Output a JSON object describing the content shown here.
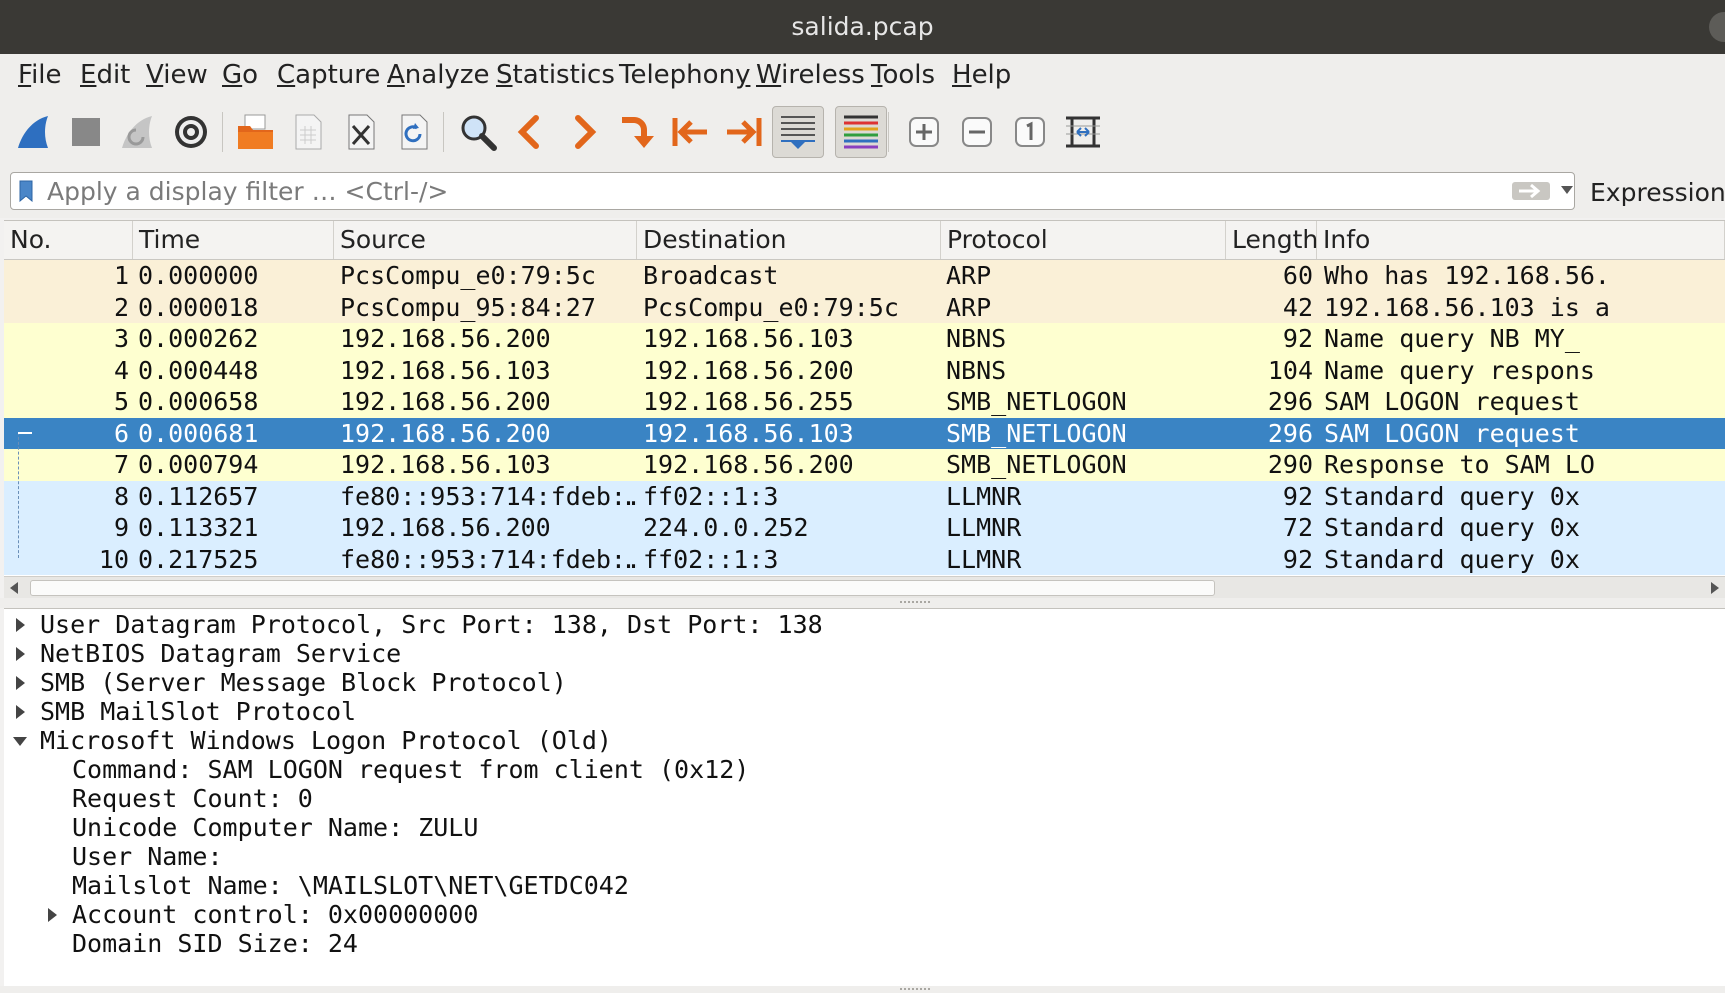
{
  "window": {
    "title": "salida.pcap"
  },
  "menu": [
    {
      "label": "File",
      "mnemonic": "F",
      "rest": "ile"
    },
    {
      "label": "Edit",
      "mnemonic": "E",
      "rest": "dit"
    },
    {
      "label": "View",
      "mnemonic": "V",
      "rest": "iew"
    },
    {
      "label": "Go",
      "mnemonic": "G",
      "rest": "o"
    },
    {
      "label": "Capture",
      "mnemonic": "C",
      "rest": "apture"
    },
    {
      "label": "Analyze",
      "mnemonic": "A",
      "rest": "nalyze"
    },
    {
      "label": "Statistics",
      "mnemonic": "S",
      "rest": "tatistics"
    },
    {
      "label": "Telephony",
      "mnemonic": "y",
      "rest": "Telephon"
    },
    {
      "label": "Wireless",
      "mnemonic": "W",
      "rest": "ireless"
    },
    {
      "label": "Tools",
      "mnemonic": "T",
      "rest": "ools"
    },
    {
      "label": "Help",
      "mnemonic": "H",
      "rest": "elp"
    }
  ],
  "toolbar": {
    "icons": [
      "shark-fin-start-icon",
      "stop-icon",
      "restart-icon",
      "capture-options-gear-icon",
      "open-file-icon",
      "save-file-icon",
      "close-file-icon",
      "reload-icon",
      "find-packet-search-icon",
      "previous-packet-icon",
      "next-packet-icon",
      "go-to-packet-icon",
      "first-packet-icon",
      "last-packet-icon",
      "autoscroll-icon",
      "colorize-icon",
      "zoom-in-icon",
      "zoom-out-icon",
      "normal-size-icon",
      "resize-columns-icon"
    ]
  },
  "filter": {
    "placeholder": "Apply a display filter … <Ctrl-/>",
    "value": "",
    "expression_label": "Expression…"
  },
  "packet_list": {
    "columns": [
      "No.",
      "Time",
      "Source",
      "Destination",
      "Protocol",
      "Length",
      "Info"
    ],
    "selected_no": "6",
    "rows": [
      {
        "no": "1",
        "time": "0.000000",
        "source": "PcsCompu_e0:79:5c",
        "destination": "Broadcast",
        "protocol": "ARP",
        "length": "60",
        "info": "Who has 192.168.56.",
        "color": "#faf0d7"
      },
      {
        "no": "2",
        "time": "0.000018",
        "source": "PcsCompu_95:84:27",
        "destination": "PcsCompu_e0:79:5c",
        "protocol": "ARP",
        "length": "42",
        "info": "192.168.56.103 is a",
        "color": "#faf0d7"
      },
      {
        "no": "3",
        "time": "0.000262",
        "source": "192.168.56.200",
        "destination": "192.168.56.103",
        "protocol": "NBNS",
        "length": "92",
        "info": "Name query NB MY_",
        "color": "#feffd0"
      },
      {
        "no": "4",
        "time": "0.000448",
        "source": "192.168.56.103",
        "destination": "192.168.56.200",
        "protocol": "NBNS",
        "length": "104",
        "info": "Name query respons",
        "color": "#feffd0"
      },
      {
        "no": "5",
        "time": "0.000658",
        "source": "192.168.56.200",
        "destination": "192.168.56.255",
        "protocol": "SMB_NETLOGON",
        "length": "296",
        "info": "SAM LOGON request",
        "color": "#feffd0"
      },
      {
        "no": "6",
        "time": "0.000681",
        "source": "192.168.56.200",
        "destination": "192.168.56.103",
        "protocol": "SMB_NETLOGON",
        "length": "296",
        "info": "SAM LOGON request",
        "color": "#3a84c4"
      },
      {
        "no": "7",
        "time": "0.000794",
        "source": "192.168.56.103",
        "destination": "192.168.56.200",
        "protocol": "SMB_NETLOGON",
        "length": "290",
        "info": "Response to SAM LO",
        "color": "#feffd0"
      },
      {
        "no": "8",
        "time": "0.112657",
        "source": "fe80::953:714:fdeb:…",
        "destination": "ff02::1:3",
        "protocol": "LLMNR",
        "length": "92",
        "info": "Standard query 0x",
        "color": "#daeeff"
      },
      {
        "no": "9",
        "time": "0.113321",
        "source": "192.168.56.200",
        "destination": "224.0.0.252",
        "protocol": "LLMNR",
        "length": "72",
        "info": "Standard query 0x",
        "color": "#daeeff"
      },
      {
        "no": "10",
        "time": "0.217525",
        "source": "fe80::953:714:fdeb:…",
        "destination": "ff02::1:3",
        "protocol": "LLMNR",
        "length": "92",
        "info": "Standard query 0x",
        "color": "#daeeff"
      }
    ]
  },
  "details": [
    {
      "text": "User Datagram Protocol, Src Port: 138, Dst Port: 138",
      "indent": 0,
      "expander": "collapsed"
    },
    {
      "text": "NetBIOS Datagram Service",
      "indent": 0,
      "expander": "collapsed"
    },
    {
      "text": "SMB (Server Message Block Protocol)",
      "indent": 0,
      "expander": "collapsed"
    },
    {
      "text": "SMB MailSlot Protocol",
      "indent": 0,
      "expander": "collapsed"
    },
    {
      "text": "Microsoft Windows Logon Protocol (Old)",
      "indent": 0,
      "expander": "expanded"
    },
    {
      "text": "Command: SAM LOGON request from client (0x12)",
      "indent": 1,
      "expander": "none"
    },
    {
      "text": "Request Count: 0",
      "indent": 1,
      "expander": "none"
    },
    {
      "text": "Unicode Computer Name: ZULU",
      "indent": 1,
      "expander": "none"
    },
    {
      "text": "User Name:",
      "indent": 1,
      "expander": "none"
    },
    {
      "text": "Mailslot Name: \\MAILSLOT\\NET\\GETDC042",
      "indent": 1,
      "expander": "none"
    },
    {
      "text": "Account control: 0x00000000",
      "indent": 1,
      "expander": "collapsed"
    },
    {
      "text": "Domain SID Size: 24",
      "indent": 1,
      "expander": "none"
    }
  ],
  "colors": {
    "selected_row": "#3a84c4",
    "arp_row": "#faf0d7",
    "smb_row": "#feffd0",
    "udp_row": "#daeeff"
  }
}
